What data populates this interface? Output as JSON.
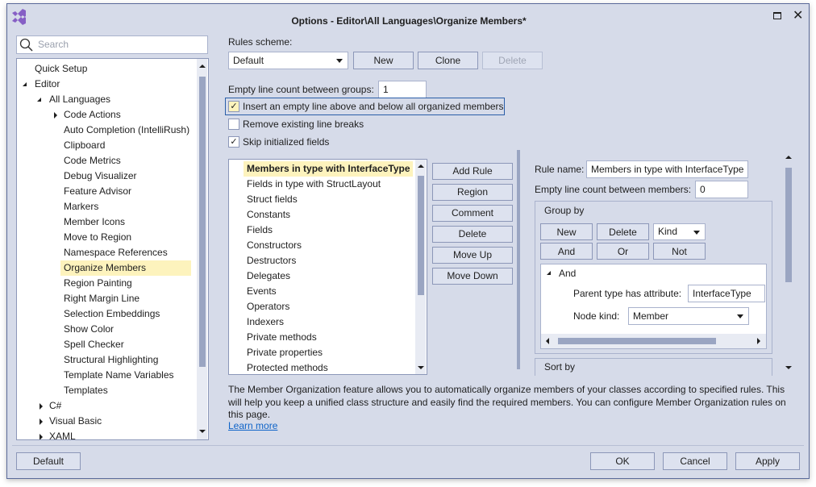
{
  "window": {
    "title": "Options - Editor\\All Languages\\Organize Members*",
    "logo": "visual-studio-logo",
    "controls": [
      "maximize-icon",
      "close-icon"
    ]
  },
  "search": {
    "placeholder": "Search"
  },
  "tree": {
    "items": [
      {
        "label": "Quick Setup",
        "level": 0,
        "expander": "none"
      },
      {
        "label": "Editor",
        "level": 0,
        "expander": "expanded"
      },
      {
        "label": "All Languages",
        "level": 1,
        "expander": "expanded"
      },
      {
        "label": "Code Actions",
        "level": 2,
        "expander": "collapsed"
      },
      {
        "label": "Auto Completion (IntelliRush)",
        "level": 2
      },
      {
        "label": "Clipboard",
        "level": 2
      },
      {
        "label": "Code Metrics",
        "level": 2
      },
      {
        "label": "Debug Visualizer",
        "level": 2
      },
      {
        "label": "Feature Advisor",
        "level": 2
      },
      {
        "label": "Markers",
        "level": 2
      },
      {
        "label": "Member Icons",
        "level": 2
      },
      {
        "label": "Move to Region",
        "level": 2
      },
      {
        "label": "Namespace References",
        "level": 2
      },
      {
        "label": "Organize Members",
        "level": 2,
        "selected": true
      },
      {
        "label": "Region Painting",
        "level": 2
      },
      {
        "label": "Right Margin Line",
        "level": 2
      },
      {
        "label": "Selection Embeddings",
        "level": 2
      },
      {
        "label": "Show Color",
        "level": 2
      },
      {
        "label": "Spell Checker",
        "level": 2
      },
      {
        "label": "Structural Highlighting",
        "level": 2
      },
      {
        "label": "Template Name Variables",
        "level": 2
      },
      {
        "label": "Templates",
        "level": 2
      },
      {
        "label": "C#",
        "level": 1,
        "expander": "collapsed"
      },
      {
        "label": "Visual Basic",
        "level": 1,
        "expander": "collapsed"
      },
      {
        "label": "XAML",
        "level": 1,
        "expander": "collapsed"
      }
    ]
  },
  "scheme": {
    "label": "Rules scheme:",
    "value": "Default",
    "new": "New",
    "clone": "Clone",
    "delete": "Delete"
  },
  "groups": {
    "label": "Empty line count between groups:",
    "value": "1"
  },
  "options": [
    {
      "label": "Insert an empty line above and below all organized members",
      "checked": true
    },
    {
      "label": "Remove existing line breaks",
      "checked": false
    },
    {
      "label": "Skip initialized fields",
      "checked": true
    }
  ],
  "rules": {
    "items": [
      "Members in type with InterfaceType",
      "Fields in type with StructLayout",
      "Struct fields",
      "Constants",
      "Fields",
      "Constructors",
      "Destructors",
      "Delegates",
      "Events",
      "Operators",
      "Indexers",
      "Private methods",
      "Private properties",
      "Protected methods"
    ],
    "selected": 0
  },
  "rule_buttons": [
    "Add Rule",
    "Region",
    "Comment",
    "Delete",
    "Move Up",
    "Move Down"
  ],
  "editor": {
    "rule_name_label": "Rule name:",
    "rule_name": "Members in type with InterfaceType",
    "empty_label": "Empty line count between members:",
    "empty_value": "0",
    "group_by": "Group by",
    "new": "New",
    "delete": "Delete",
    "kind": "Kind",
    "and": "And",
    "or": "Or",
    "not": "Not",
    "node": "And",
    "attr_label": "Parent type has attribute:",
    "attr_value": "InterfaceType",
    "kind_label": "Node kind:",
    "kind_value": "Member",
    "sort_by": "Sort by"
  },
  "description": "The Member Organization feature allows you to automatically organize members of your classes according to specified rules. This will help you keep a unified class structure and easily find the required members. You can configure Member Organization rules on this page.",
  "learn_more": "Learn more",
  "footer": {
    "default": "Default",
    "ok": "OK",
    "cancel": "Cancel",
    "apply": "Apply"
  },
  "colors": {
    "background": "#d6dbe9",
    "selection": "#fdf3bd",
    "accent": "#68217a",
    "link": "#0e63c8"
  }
}
